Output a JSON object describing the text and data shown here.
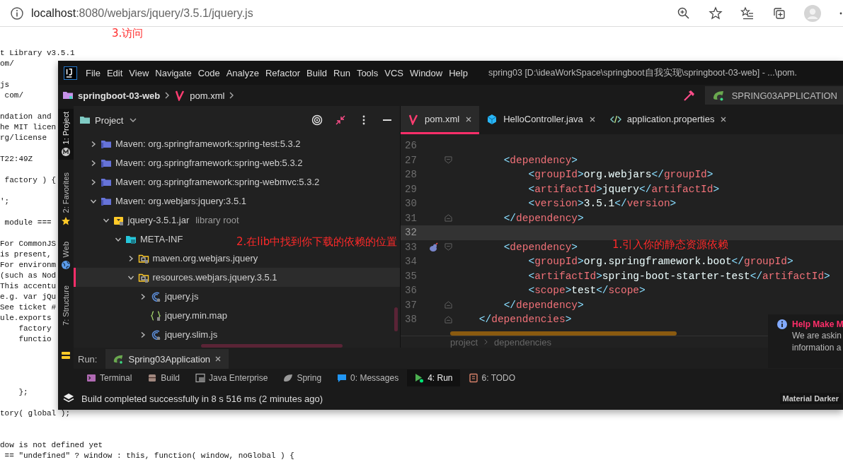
{
  "browser": {
    "address": {
      "host": "localhost",
      "path": ":8080/webjars/jquery/3.5.1/jquery.js"
    },
    "annotation": "3.访问",
    "page_lines": [
      {
        "kind": "text",
        "text": "t Library v3.5.1"
      },
      {
        "kind": "text",
        "text": "om/"
      },
      {
        "kind": "blank"
      },
      {
        "kind": "text",
        "text": "js"
      },
      {
        "kind": "text",
        "text": " com/"
      },
      {
        "kind": "blank"
      },
      {
        "kind": "text",
        "text": "ndation and"
      },
      {
        "kind": "text",
        "text": "he MIT licen"
      },
      {
        "kind": "text",
        "text": "rg/license"
      },
      {
        "kind": "blank"
      },
      {
        "kind": "text",
        "text": "T22:49Z"
      },
      {
        "kind": "blank"
      },
      {
        "kind": "text",
        "text": " factory ) {"
      },
      {
        "kind": "blank"
      },
      {
        "kind": "text",
        "text": "';"
      },
      {
        "kind": "blank"
      },
      {
        "kind": "text",
        "text": " module ==="
      },
      {
        "kind": "blank"
      },
      {
        "kind": "text",
        "text": "For CommonJS"
      },
      {
        "kind": "text",
        "text": "is present,"
      },
      {
        "kind": "text",
        "text": "For environm"
      },
      {
        "kind": "text",
        "text": "(such as Nod"
      },
      {
        "kind": "text",
        "text": "This accentu"
      },
      {
        "kind": "text",
        "text": "e.g. var jQu"
      },
      {
        "kind": "text",
        "text": "See ticket #"
      },
      {
        "kind": "text",
        "text": "ule.exports"
      },
      {
        "kind": "text",
        "text": "    factory"
      },
      {
        "kind": "text",
        "text": "    functio"
      },
      {
        "kind": "blank"
      },
      {
        "kind": "blank"
      },
      {
        "kind": "blank"
      },
      {
        "kind": "blank"
      },
      {
        "kind": "text",
        "text": "    };"
      },
      {
        "kind": "blank"
      },
      {
        "kind": "text",
        "text": "tory( global );"
      },
      {
        "kind": "blank"
      },
      {
        "kind": "blank"
      },
      {
        "kind": "text",
        "text": "dow is not defined yet"
      },
      {
        "kind": "text",
        "text": " == \"undefined\" ? window : this, function( window, noGlobal ) {"
      }
    ]
  },
  "ide": {
    "menu": [
      "File",
      "Edit",
      "View",
      "Navigate",
      "Code",
      "Analyze",
      "Refactor",
      "Build",
      "Run",
      "Tools",
      "VCS",
      "Window",
      "Help"
    ],
    "title": "spring03 [D:\\ideaWorkSpace\\springboot自我实现\\springboot-03-web] - ...\\pom.",
    "breadcrumb": {
      "project": "springboot-03-web",
      "file": "pom.xml"
    },
    "run_config": "SPRING03APPLICATION",
    "side_tabs": [
      {
        "label": "1: Project",
        "kind": "project",
        "selected": true
      },
      {
        "label": "2: Favorites",
        "kind": "favorites",
        "selected": false
      },
      {
        "label": "Web",
        "kind": "web",
        "selected": false
      },
      {
        "label": "7: Structure",
        "kind": "structure",
        "selected": false
      }
    ],
    "project": {
      "title": "Project",
      "annotation": "2.在lib中找到你下载的依赖的位置",
      "tree": [
        {
          "label": "Maven: org.springframework:spring-test:5.3.2",
          "kind": "maven",
          "expanded": false,
          "selected": false
        },
        {
          "label": "Maven: org.springframework:spring-web:5.3.2",
          "kind": "maven",
          "expanded": false,
          "selected": false
        },
        {
          "label": "Maven: org.springframework:spring-webmvc:5.3.2",
          "kind": "maven",
          "expanded": false,
          "selected": false
        },
        {
          "label": "Maven: org.webjars:jquery:3.5.1",
          "kind": "maven",
          "expanded": true,
          "selected": false,
          "children": [
            {
              "label": "jquery-3.5.1.jar",
              "hint": "library root",
              "kind": "jar",
              "expanded": true,
              "selected": false,
              "children": [
                {
                  "label": "META-INF",
                  "kind": "meta",
                  "expanded": true,
                  "selected": false,
                  "children": [
                    {
                      "label": "maven.org.webjars.jquery",
                      "kind": "package",
                      "expanded": false,
                      "selected": false
                    },
                    {
                      "label": "resources.webjars.jquery.3.5.1",
                      "kind": "package",
                      "expanded": true,
                      "selected": true,
                      "children": [
                        {
                          "label": "jquery.js",
                          "kind": "js",
                          "expanded": false,
                          "selected": false
                        },
                        {
                          "label": "jquery.min.map",
                          "kind": "map",
                          "selected": false
                        },
                        {
                          "label": "jquery.slim.js",
                          "kind": "js",
                          "expanded": false,
                          "selected": false
                        }
                      ]
                    }
                  ]
                }
              ]
            }
          ]
        }
      ]
    },
    "editor": {
      "annotation": "1.引入你的静态资源依赖",
      "tabs": [
        {
          "label": "pom.xml",
          "kind": "maven",
          "selected": true
        },
        {
          "label": "HelloController.java",
          "kind": "java",
          "selected": false
        },
        {
          "label": "application.properties",
          "kind": "properties",
          "selected": false
        }
      ],
      "lines": [
        {
          "number": "26",
          "fold_open": false,
          "fold_close": false,
          "run_icon": false,
          "current": false
        },
        {
          "number": "27",
          "code": "        <dependency>",
          "fold_open": true,
          "fold_close": false,
          "run_icon": false,
          "current": false
        },
        {
          "number": "28",
          "code": "            <groupId>org.webjars</groupId>",
          "fold_open": false,
          "fold_close": false,
          "run_icon": false,
          "current": false
        },
        {
          "number": "29",
          "code": "            <artifactId>jquery</artifactId>",
          "fold_open": false,
          "fold_close": false,
          "run_icon": false,
          "current": false
        },
        {
          "number": "30",
          "code": "            <version>3.5.1</version>",
          "fold_open": false,
          "fold_close": false,
          "run_icon": false,
          "current": false
        },
        {
          "number": "31",
          "code": "        </dependency>",
          "fold_open": false,
          "fold_close": true,
          "run_icon": false,
          "current": false
        },
        {
          "number": "32",
          "fold_open": false,
          "fold_close": false,
          "run_icon": false,
          "current": true
        },
        {
          "number": "33",
          "code": "        <dependency>",
          "fold_open": true,
          "fold_close": false,
          "run_icon": true,
          "current": false
        },
        {
          "number": "34",
          "code": "            <groupId>org.springframework.boot</groupId>",
          "fold_open": false,
          "fold_close": false,
          "run_icon": false,
          "current": false
        },
        {
          "number": "35",
          "code": "            <artifactId>spring-boot-starter-test</artifactId>",
          "fold_open": false,
          "fold_close": false,
          "run_icon": false,
          "current": false
        },
        {
          "number": "36",
          "code": "            <scope>test</scope>",
          "fold_open": false,
          "fold_close": false,
          "run_icon": false,
          "current": false
        },
        {
          "number": "37",
          "code": "        </dependency>",
          "fold_open": false,
          "fold_close": true,
          "run_icon": false,
          "current": false
        },
        {
          "number": "38",
          "code": "    </dependencies>",
          "fold_open": false,
          "fold_close": true,
          "run_icon": false,
          "current": false
        }
      ],
      "path": [
        "project",
        "dependencies"
      ]
    },
    "notification": {
      "title": "Help Make M",
      "body": [
        "We are askin",
        "information a"
      ]
    },
    "run": {
      "label": "Run:",
      "tab": "Spring03Application"
    },
    "tool_windows": [
      {
        "label": "Terminal",
        "kind": "terminal",
        "selected": false
      },
      {
        "label": "Build",
        "kind": "build",
        "selected": false
      },
      {
        "label": "Java Enterprise",
        "kind": "javaee",
        "selected": false
      },
      {
        "label": "Spring",
        "kind": "spring",
        "selected": false
      },
      {
        "label": "0: Messages",
        "kind": "messages",
        "selected": false
      },
      {
        "label": "4: Run",
        "kind": "run",
        "selected": true
      },
      {
        "label": "6: TODO",
        "kind": "todo",
        "selected": false
      }
    ],
    "status": "Build completed successfully in 8 s 516 ms (2 minutes ago)",
    "theme": "Material Darker"
  }
}
